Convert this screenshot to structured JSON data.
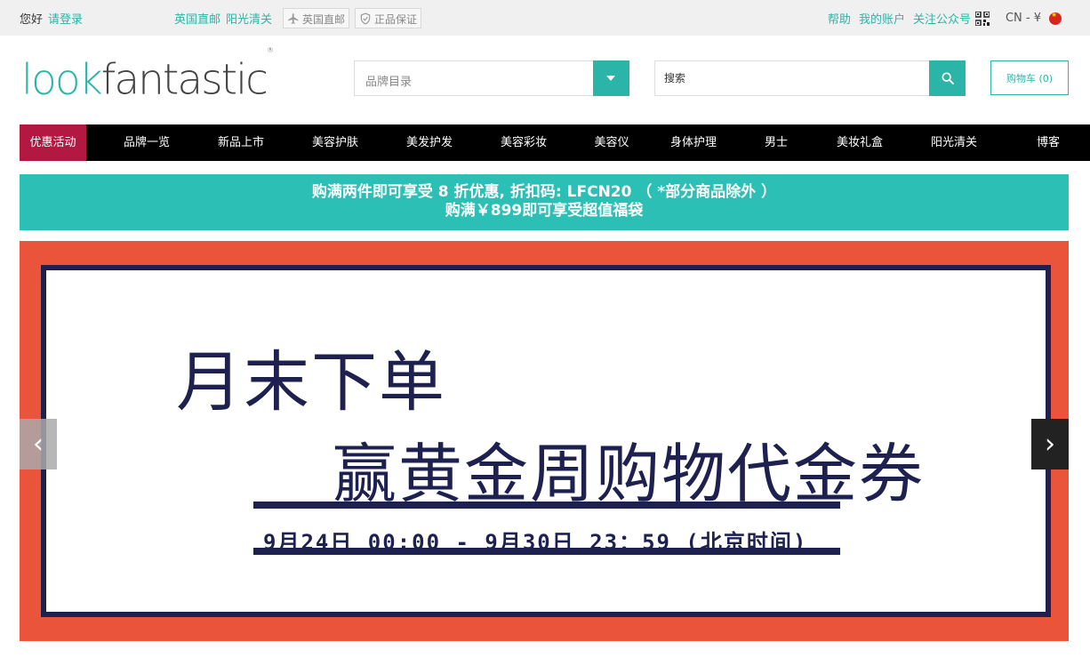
{
  "topbar": {
    "greeting": "您好",
    "login": "请登录",
    "link_uk": "英国直邮",
    "link_customs": "阳光清关",
    "badge_uk": "英国直邮",
    "badge_genuine": "正品保证",
    "help": "帮助",
    "account": "我的账户",
    "follow": "关注公众号",
    "region": "CN - ¥"
  },
  "header": {
    "logo_look": "look",
    "logo_fantastic": "fantastic",
    "logo_reg": "®",
    "brand_select_placeholder": "品牌目录",
    "search_placeholder": "搜索",
    "cart_label": "购物车 (0)"
  },
  "nav": {
    "items": [
      "优惠活动",
      "品牌一览",
      "新品上市",
      "美容护肤",
      "美发护发",
      "美容彩妆",
      "美容仪",
      "身体护理",
      "男士",
      "美妆礼盒",
      "阳光清关",
      "博客"
    ]
  },
  "promo": {
    "line1": "购满两件即可享受 8 折优惠, 折扣码: LFCN20 （ *部分商品除外 ）",
    "line2": "购满￥899即可享受超值福袋"
  },
  "banner": {
    "line1": "月末下单",
    "line2": "赢黄金周购物代金券",
    "date": "9月24日 00:00 - 9月30日 23：59 (北京时间)"
  },
  "carousel": {
    "prev": "‹",
    "next": "›"
  },
  "colors": {
    "accent": "#2bb5a8",
    "nav_active": "#b31842",
    "banner_bg": "#e9543a",
    "banner_ink": "#1e2150"
  }
}
